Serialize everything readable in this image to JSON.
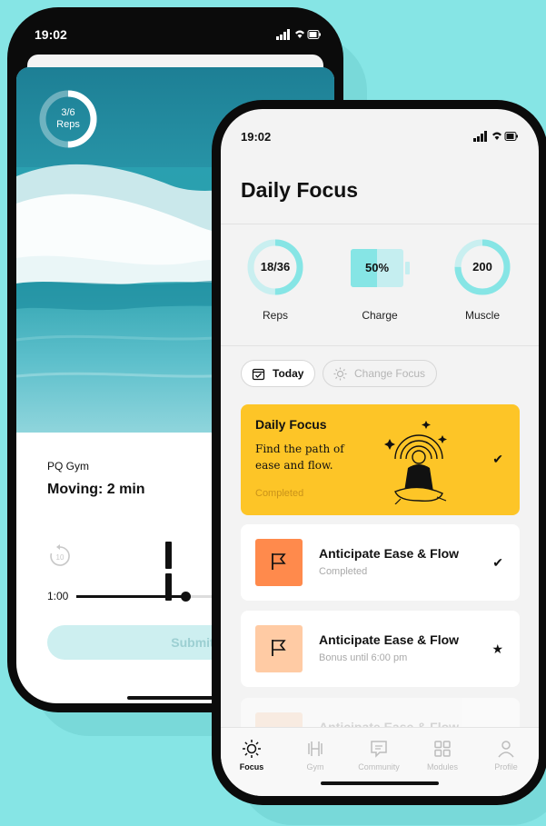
{
  "back_phone": {
    "status_time": "19:02",
    "reps_ring": {
      "value": "3/6",
      "label": "Reps",
      "progress": 0.5
    },
    "gym_name": "PQ Gym",
    "activity": "Moving: 2 min",
    "rewind_seconds": "10",
    "elapsed": "1:00",
    "playback_progress": 0.5,
    "submit_label": "Submit"
  },
  "front_phone": {
    "status_time": "19:02",
    "page_title": "Daily Focus",
    "stats": [
      {
        "value": "18/36",
        "label": "Reps",
        "progress": 0.5
      },
      {
        "value": "50%",
        "label": "Charge",
        "progress": 0.5
      },
      {
        "value": "200",
        "label": "Muscle",
        "progress": 0.75
      }
    ],
    "chips": {
      "today": "Today",
      "change": "Change Focus"
    },
    "daily_card": {
      "title": "Daily Focus",
      "description": "Find the path of ease and flow.",
      "status": "Completed"
    },
    "tasks": [
      {
        "title": "Anticipate Ease & Flow",
        "subtitle": "Completed",
        "mark": "✔"
      },
      {
        "title": "Anticipate Ease & Flow",
        "subtitle": "Bonus until 6:00 pm",
        "mark": "★"
      },
      {
        "title": "Anticipate Ease & Flow"
      }
    ],
    "tabs": [
      {
        "label": "Focus",
        "icon": "sun-icon",
        "active": true
      },
      {
        "label": "Gym",
        "icon": "dumbbell-icon"
      },
      {
        "label": "Community",
        "icon": "chat-icon"
      },
      {
        "label": "Modules",
        "icon": "grid-icon"
      },
      {
        "label": "Profile",
        "icon": "person-icon"
      }
    ]
  },
  "colors": {
    "background": "#86e5e5",
    "accent_yellow": "#fdc527",
    "task_orange": "#ff8a4c",
    "task_peach": "#ffcba4",
    "teal_ring": "#86e5e5"
  }
}
